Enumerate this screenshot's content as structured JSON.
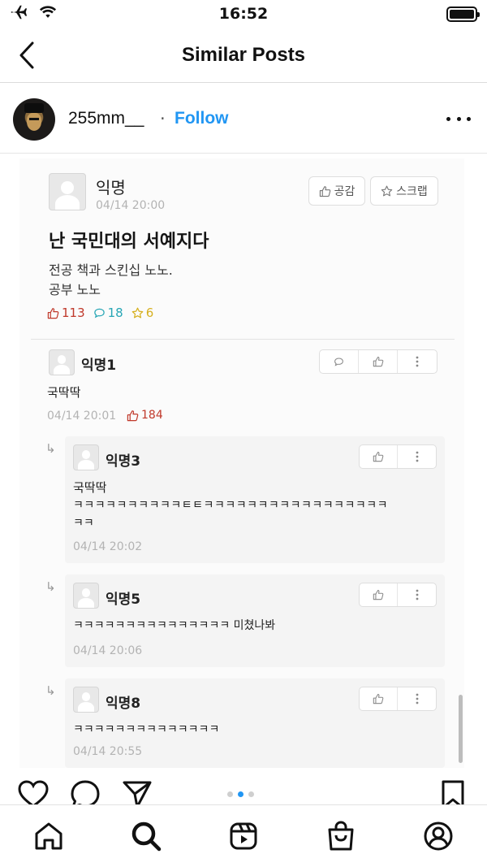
{
  "status_bar": {
    "time": "16:52"
  },
  "header": {
    "title": "Similar Posts"
  },
  "post": {
    "username": "255mm__",
    "separator": "·",
    "follow_label": "Follow"
  },
  "embedded": {
    "post": {
      "author": "익명",
      "time": "04/14 20:00",
      "empathy_label": "공감",
      "scrap_label": "스크랩",
      "title": "난 국민대의 서예지다",
      "body_lines": [
        "전공 책과 스킨십 노노.",
        "공부 노노"
      ],
      "likes": "113",
      "comments": "18",
      "scraps": "6"
    },
    "comments": [
      {
        "author": "익명1",
        "text": "국딱딱",
        "time": "04/14 20:01",
        "likes": "184"
      }
    ],
    "replies": [
      {
        "author": "익명3",
        "lines": [
          "국딱딱",
          "ㅋㅋㅋㅋㅋㅋㅋㅋㅋㅋㅌㅌㅋㅋㅋㅋㅋㅋㅋㅋㅋㅋㅋㅋㅋㅋㅋㅋㅋ",
          "ㅋㅋ"
        ],
        "time": "04/14 20:02"
      },
      {
        "author": "익명5",
        "lines": [
          "ㅋㅋㅋㅋㅋㅋㅋㅋㅋㅋㅋㅋㅋㅋㅋ 미쳤나봐"
        ],
        "time": "04/14 20:06"
      },
      {
        "author": "익명8",
        "lines": [
          "ㅋㅋㅋㅋㅋㅋㅋㅋㅋㅋㅋㅋㅋㅋ"
        ],
        "time": "04/14 20:55"
      }
    ]
  },
  "carousel": {
    "count": 3,
    "active_index": 1
  },
  "colors": {
    "accent": "#2196f3",
    "like": "#c0392b",
    "comment": "#27a6b5",
    "scrap": "#d6b020"
  }
}
